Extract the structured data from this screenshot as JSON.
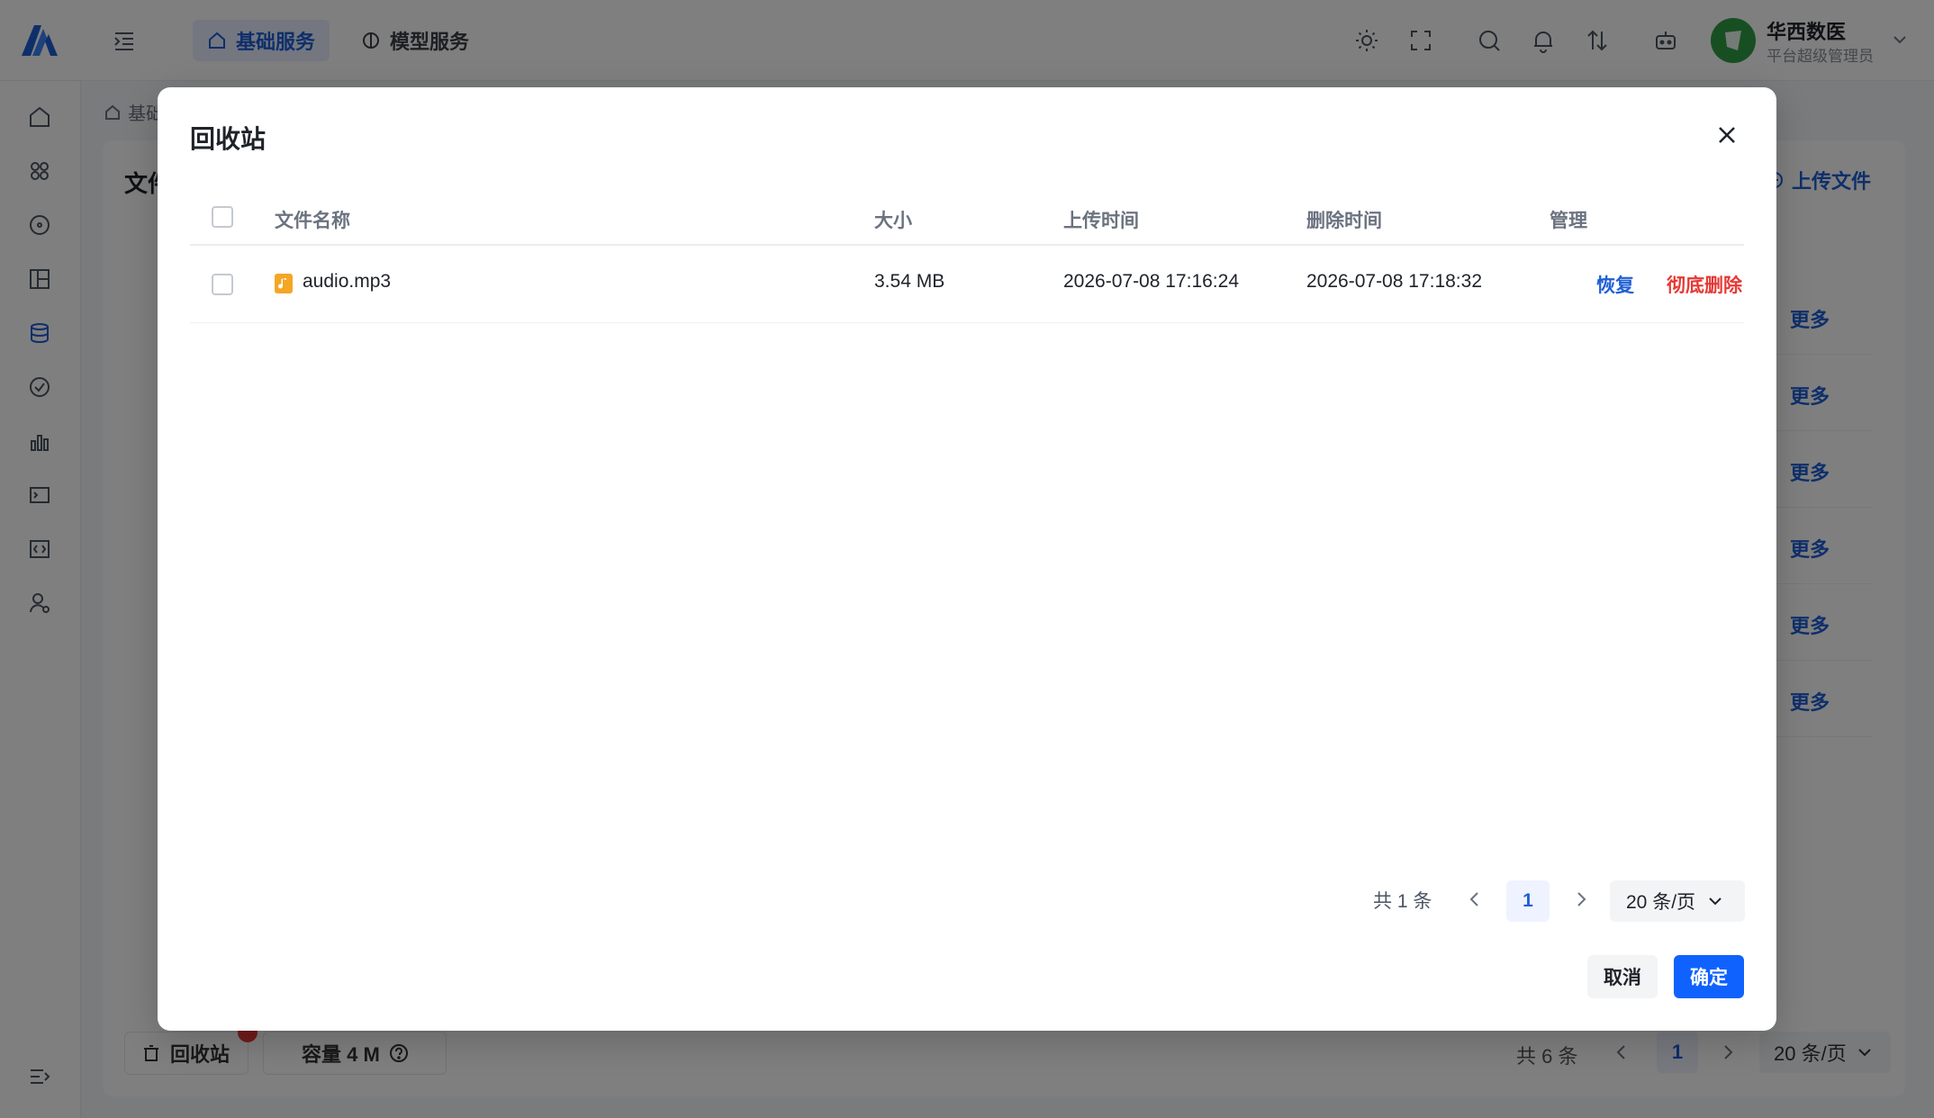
{
  "colors": {
    "accent": "#1f5fd6",
    "primary_button": "#0f62fe",
    "danger": "#e53935",
    "file_icon": "#f5a623"
  },
  "topbar": {
    "logo_icon": "brand-logo",
    "collapse_icon": "indent-icon",
    "tabs": [
      {
        "label": "基础服务",
        "icon": "home-icon",
        "active": true
      },
      {
        "label": "模型服务",
        "icon": "brain-icon",
        "active": false
      }
    ],
    "icons": [
      "sun-icon",
      "fullscreen-icon",
      "search-icon",
      "bell-icon",
      "sort-icon",
      "robot-icon"
    ],
    "user": {
      "name": "华西数医",
      "role": "平台超级管理员"
    }
  },
  "sidebar": {
    "icons": [
      "home-icon",
      "apps-icon",
      "dashboard-icon",
      "layout-icon",
      "database-icon",
      "check-circle-icon",
      "bar-chart-icon",
      "terminal-icon",
      "code-icon",
      "user-settings-icon",
      "collapse-sidebar-icon"
    ]
  },
  "background": {
    "breadcrumb": "基础",
    "panel_title": "文件",
    "upload_label": "上传文件",
    "more_label": "更多",
    "recycle_label": "回收站",
    "capacity_label": "容量 4 M",
    "total_label": "共 6 条",
    "page": "1",
    "page_size": "20 条/页"
  },
  "modal": {
    "title": "回收站",
    "columns": {
      "name": "文件名称",
      "size": "大小",
      "uploaded": "上传时间",
      "deleted": "删除时间",
      "manage": "管理"
    },
    "rows": [
      {
        "name": "audio.mp3",
        "size": "3.54 MB",
        "uploaded": "2026-07-08 17:16:24",
        "deleted": "2026-07-08 17:18:32",
        "restore": "恢复",
        "delete": "彻底删除"
      }
    ],
    "pager": {
      "total": "共 1 条",
      "page": "1",
      "page_size": "20 条/页"
    },
    "cancel_label": "取消",
    "ok_label": "确定"
  }
}
